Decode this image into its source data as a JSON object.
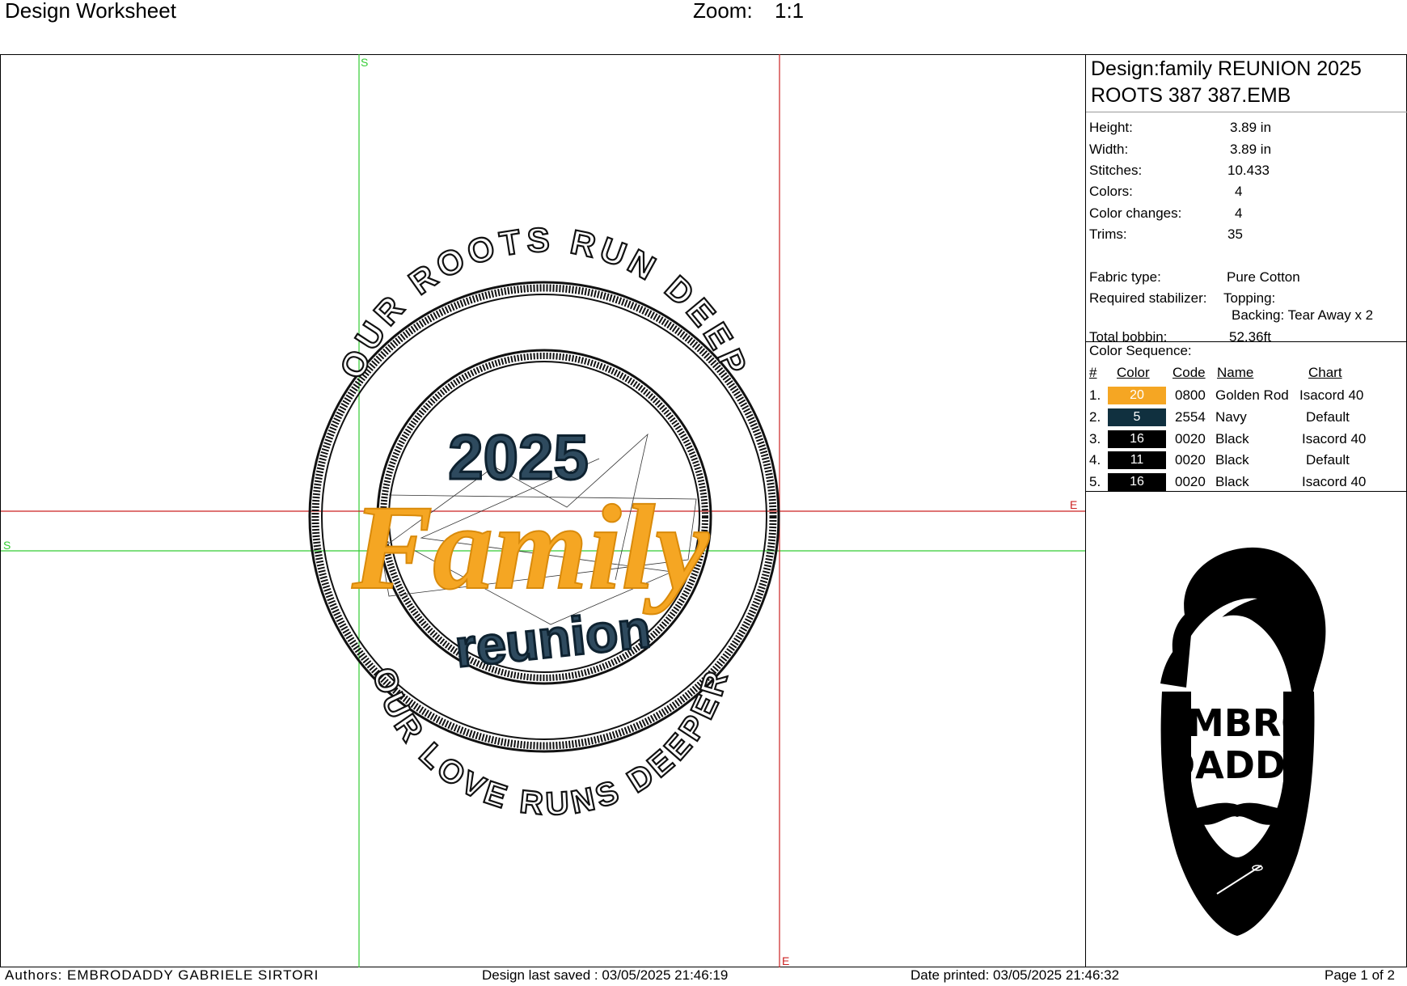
{
  "header": {
    "title": "Design Worksheet",
    "zoom_label": "Zoom:",
    "zoom_value": "1:1"
  },
  "canvas": {
    "markers": {
      "start": "S",
      "end": "E"
    },
    "design_text": {
      "top_arc": "OUR ROOTS RUN DEEP",
      "bottom_arc": "OUR LOVE RUNS DEEPER",
      "year": "2025",
      "script": "Family",
      "sub": "reunion"
    },
    "colors": {
      "gold": "#F5A623",
      "navy": "#1E3A4C",
      "black": "#111111",
      "guide_green": "#33CC33",
      "guide_red": "#CC2222"
    }
  },
  "panel": {
    "design_name_line1": "Design:family REUNION 2025",
    "design_name_line2": "ROOTS 387 387.EMB",
    "stats": [
      {
        "label": "Height:",
        "value": "3.89 in"
      },
      {
        "label": "Width:",
        "value": "3.89 in"
      },
      {
        "label": "Stitches:",
        "value": "10.433"
      },
      {
        "label": "Colors:",
        "value": "4"
      },
      {
        "label": "Color changes:",
        "value": "4"
      },
      {
        "label": "Trims:",
        "value": "35"
      }
    ],
    "fabric_label": "Fabric type:",
    "fabric_value": "Pure Cotton",
    "stabilizer_label": "Required stabilizer:",
    "stabilizer_topping": "Topping:",
    "stabilizer_backing": "Backing: Tear Away x 2",
    "bobbin_label": "Total bobbin:",
    "bobbin_value": "52.36ft",
    "sequence_title": "Color Sequence:",
    "sequence_headers": {
      "num": "#",
      "color": "Color",
      "code": "Code",
      "name": "Name",
      "chart": "Chart"
    },
    "sequence": [
      {
        "num": "1.",
        "swatch": "20",
        "hex": "#F5A623",
        "code": "0800",
        "name": "Golden Rod",
        "chart": "Isacord 40"
      },
      {
        "num": "2.",
        "swatch": "5",
        "hex": "#10303F",
        "code": "2554",
        "name": "Navy",
        "chart": "Default"
      },
      {
        "num": "3.",
        "swatch": "16",
        "hex": "#000000",
        "code": "0020",
        "name": "Black",
        "chart": "Isacord 40"
      },
      {
        "num": "4.",
        "swatch": "11",
        "hex": "#000000",
        "code": "0020",
        "name": "Black",
        "chart": "Default"
      },
      {
        "num": "5.",
        "swatch": "16",
        "hex": "#000000",
        "code": "0020",
        "name": "Black",
        "chart": "Isacord 40"
      }
    ],
    "logo": {
      "icon": "bearded-man-logo-icon",
      "line1": "EMBRO",
      "line2": "DADDY"
    }
  },
  "footer": {
    "authors": "Authors: EMBRODADDY GABRIELE SIRTORI",
    "saved": "Design last saved : 03/05/2025 21:46:19",
    "printed": "Date printed: 03/05/2025 21:46:32",
    "page": "Page 1 of 2"
  }
}
